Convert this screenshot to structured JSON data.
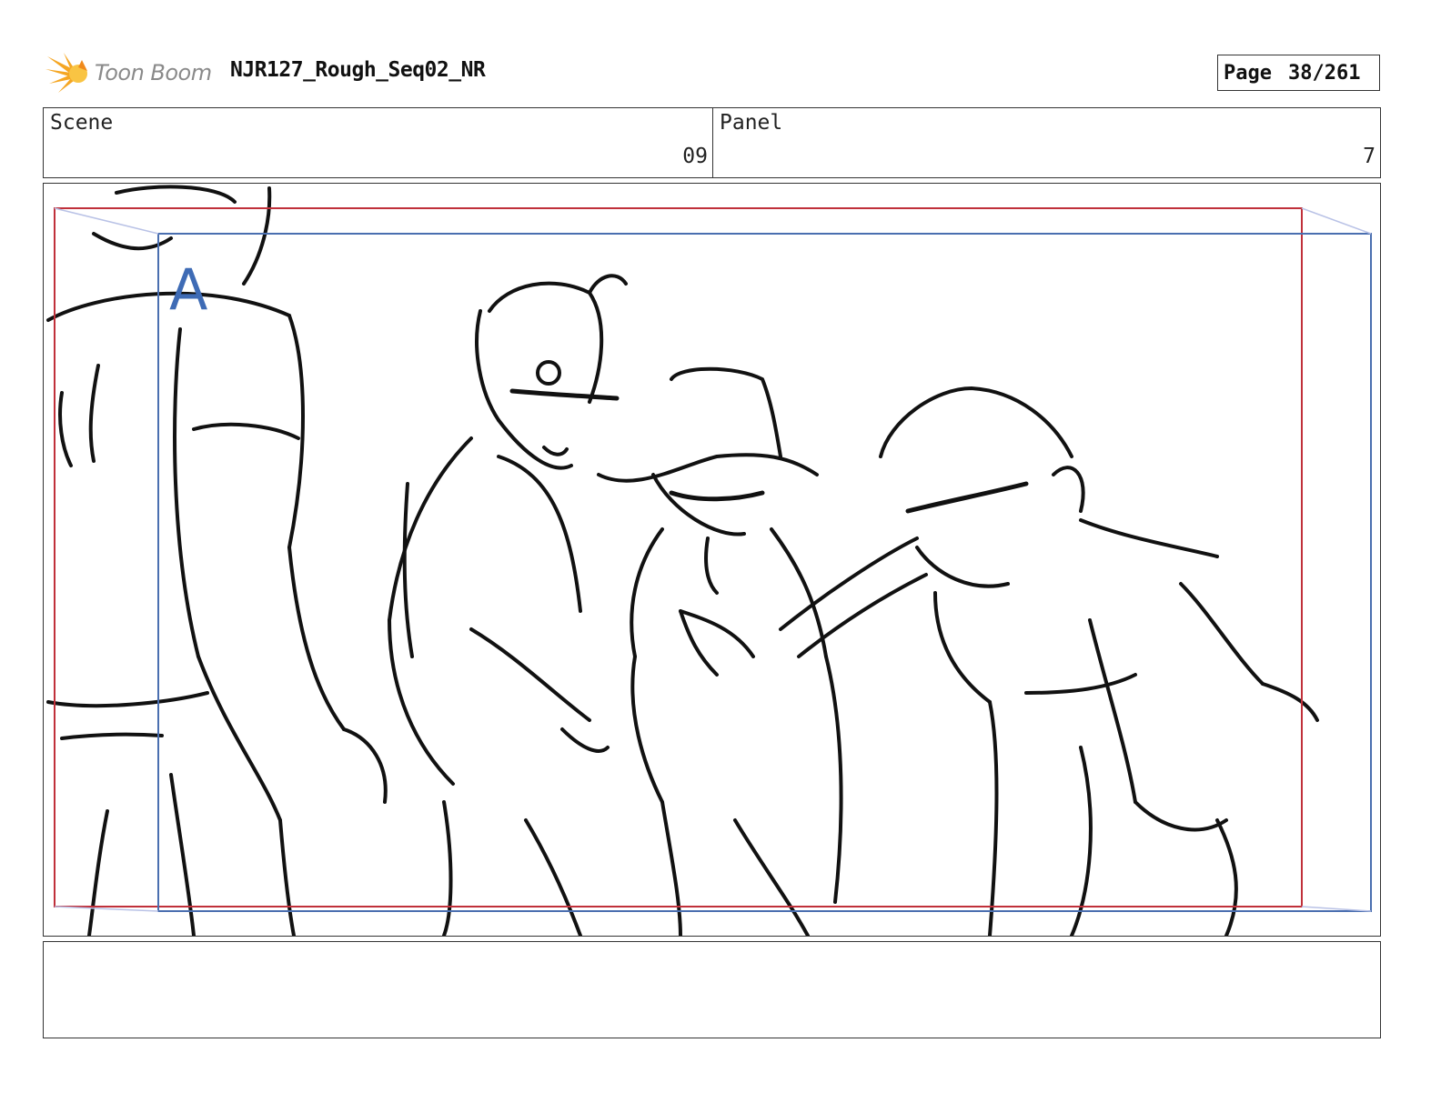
{
  "header": {
    "brand": "Toon Boom",
    "project_title": "NJR127_Rough_Seq02_NR",
    "page_label": "Page",
    "page_number": "38/261"
  },
  "info": {
    "scene_label": "Scene",
    "scene_value": "09",
    "panel_label": "Panel",
    "panel_value": "7"
  },
  "frame": {
    "camera_marker": "A",
    "colors": {
      "camera_frame_red": "#c0303a",
      "camera_frame_blue": "#4a6fb0",
      "logo_orange": "#f5a623"
    }
  },
  "notes": {
    "text": ""
  }
}
